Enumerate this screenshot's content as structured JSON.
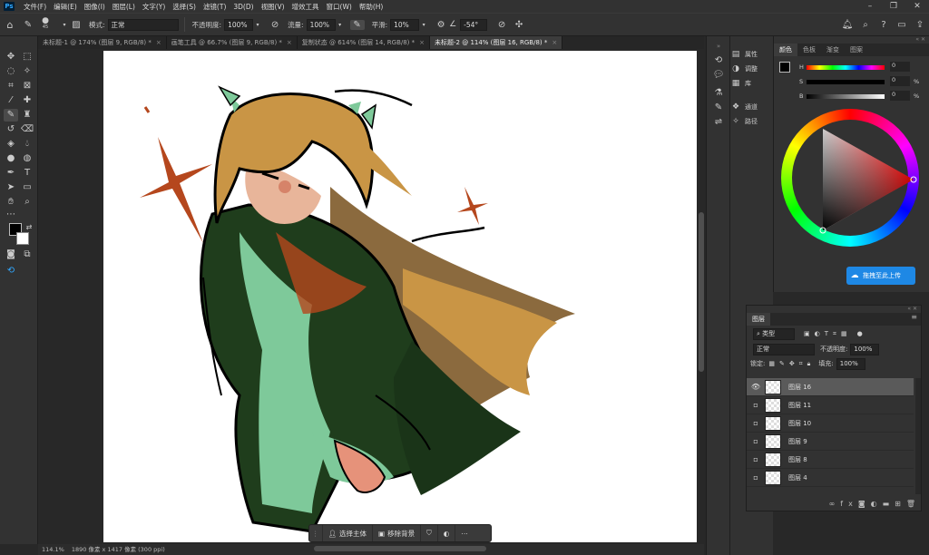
{
  "app": {
    "logo": "Ps"
  },
  "menu": [
    "文件(F)",
    "编辑(E)",
    "图像(I)",
    "图层(L)",
    "文字(Y)",
    "选择(S)",
    "滤镜(T)",
    "3D(D)",
    "视图(V)",
    "增效工具",
    "窗口(W)",
    "帮助(H)"
  ],
  "options": {
    "brush_size": "45",
    "mode_label": "模式:",
    "mode_value": "正常",
    "opacity_label": "不透明度:",
    "opacity_value": "100%",
    "flow_label": "流量:",
    "flow_value": "100%",
    "smooth_label": "平滑:",
    "smooth_value": "10%",
    "angle_value": "-54°"
  },
  "tabs": [
    {
      "label": "未标题-1 @ 174% (图层 9, RGB/8) *"
    },
    {
      "label": "画笔工具 @ 66.7% (图层 9, RGB/8) *"
    },
    {
      "label": "复制状态 @ 614% (图层 14, RGB/8) *"
    },
    {
      "label": "未标题-2 @ 114% (图层 16, RGB/8) *"
    }
  ],
  "context_bar": {
    "select_subject": "选择主体",
    "remove_bg": "移除背景"
  },
  "status": {
    "zoom": "114.1%",
    "doc_info": "1890 像素 x 1417 像素 (300 ppi)"
  },
  "dock": {
    "properties": "属性",
    "adjustments": "调整",
    "libraries": "库",
    "channels": "通道",
    "paths": "路径"
  },
  "color_panel": {
    "tabs": [
      "颜色",
      "色板",
      "渐变",
      "图案"
    ],
    "h_label": "H",
    "h_value": "0",
    "s_label": "S",
    "s_value": "0",
    "s_unit": "%",
    "b_label": "B",
    "b_value": "0",
    "b_unit": "%",
    "upload_button": "拖拽至此上传"
  },
  "layers_panel": {
    "tab": "图层",
    "filter_label": "类型",
    "blend_mode": "正常",
    "opacity_label": "不透明度:",
    "opacity_value": "100%",
    "lock_label": "锁定:",
    "fill_label": "填充:",
    "fill_value": "100%",
    "layers": [
      {
        "name": "图层 16",
        "visible": true,
        "selected": true
      },
      {
        "name": "图层 11",
        "visible": false,
        "selected": false
      },
      {
        "name": "图层 10",
        "visible": false,
        "selected": false
      },
      {
        "name": "图层 9",
        "visible": false,
        "selected": false
      },
      {
        "name": "图层 8",
        "visible": false,
        "selected": false
      },
      {
        "name": "图层 4",
        "visible": false,
        "selected": false
      }
    ]
  },
  "colors": {
    "accent": "#31a8ff",
    "upload_button": "#1e88e5",
    "foreground": "#000000",
    "background": "#ffffff"
  }
}
